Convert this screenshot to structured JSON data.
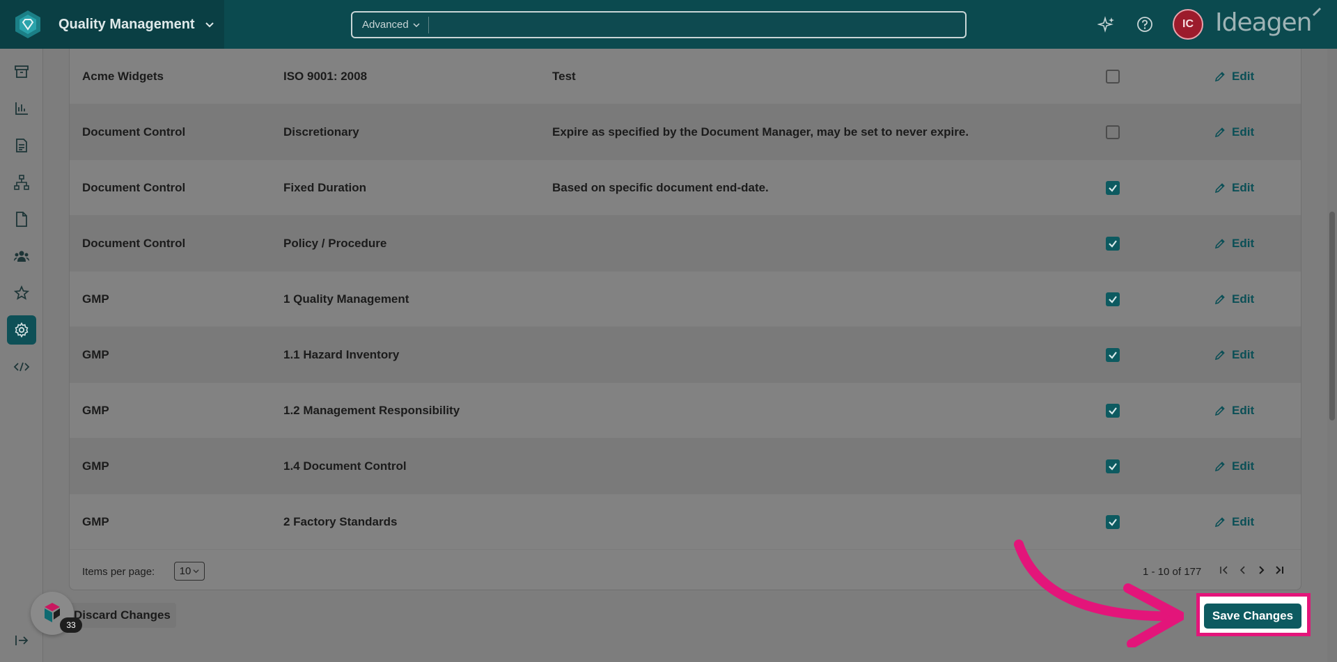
{
  "header": {
    "app_title": "Quality Management",
    "search_mode": "Advanced",
    "search_placeholder": "",
    "avatar_initials": "IC",
    "company_logo": "Ideagen"
  },
  "sidebar": {
    "items": [
      {
        "icon": "archive-icon"
      },
      {
        "icon": "bar-chart-icon"
      },
      {
        "icon": "document-list-icon"
      },
      {
        "icon": "hierarchy-icon"
      },
      {
        "icon": "file-icon"
      },
      {
        "icon": "people-icon"
      },
      {
        "icon": "star-icon"
      },
      {
        "icon": "gear-icon",
        "active": true
      },
      {
        "icon": "code-icon"
      }
    ]
  },
  "table": {
    "edit_label": "Edit",
    "rows": [
      {
        "app": "Acme Widgets",
        "name": "ISO 9001: 2008",
        "description": "Test",
        "checked": false
      },
      {
        "app": "Document Control",
        "name": "Discretionary",
        "description": "Expire as specified by the Document Manager, may be set to never expire.",
        "checked": false
      },
      {
        "app": "Document Control",
        "name": "Fixed Duration",
        "description": "Based on specific document end-date.",
        "checked": true
      },
      {
        "app": "Document Control",
        "name": "Policy / Procedure",
        "description": "",
        "checked": true
      },
      {
        "app": "GMP",
        "name": "1 Quality Management",
        "description": "",
        "checked": true
      },
      {
        "app": "GMP",
        "name": "1.1 Hazard Inventory",
        "description": "",
        "checked": true
      },
      {
        "app": "GMP",
        "name": "1.2 Management Responsibility",
        "description": "",
        "checked": true
      },
      {
        "app": "GMP",
        "name": "1.4 Document Control",
        "description": "",
        "checked": true
      },
      {
        "app": "GMP",
        "name": "2 Factory Standards",
        "description": "",
        "checked": true
      }
    ]
  },
  "pagination": {
    "items_per_page_label": "Items per page:",
    "items_per_page": "10",
    "range_text": "1 - 10 of 177"
  },
  "actions": {
    "discard_label": "Discard Changes",
    "save_label": "Save Changes"
  },
  "helper": {
    "badge_count": "33"
  },
  "colors": {
    "topbar": "#0b4a4f",
    "accent": "#0d5a60",
    "highlight": "#e3157a"
  }
}
